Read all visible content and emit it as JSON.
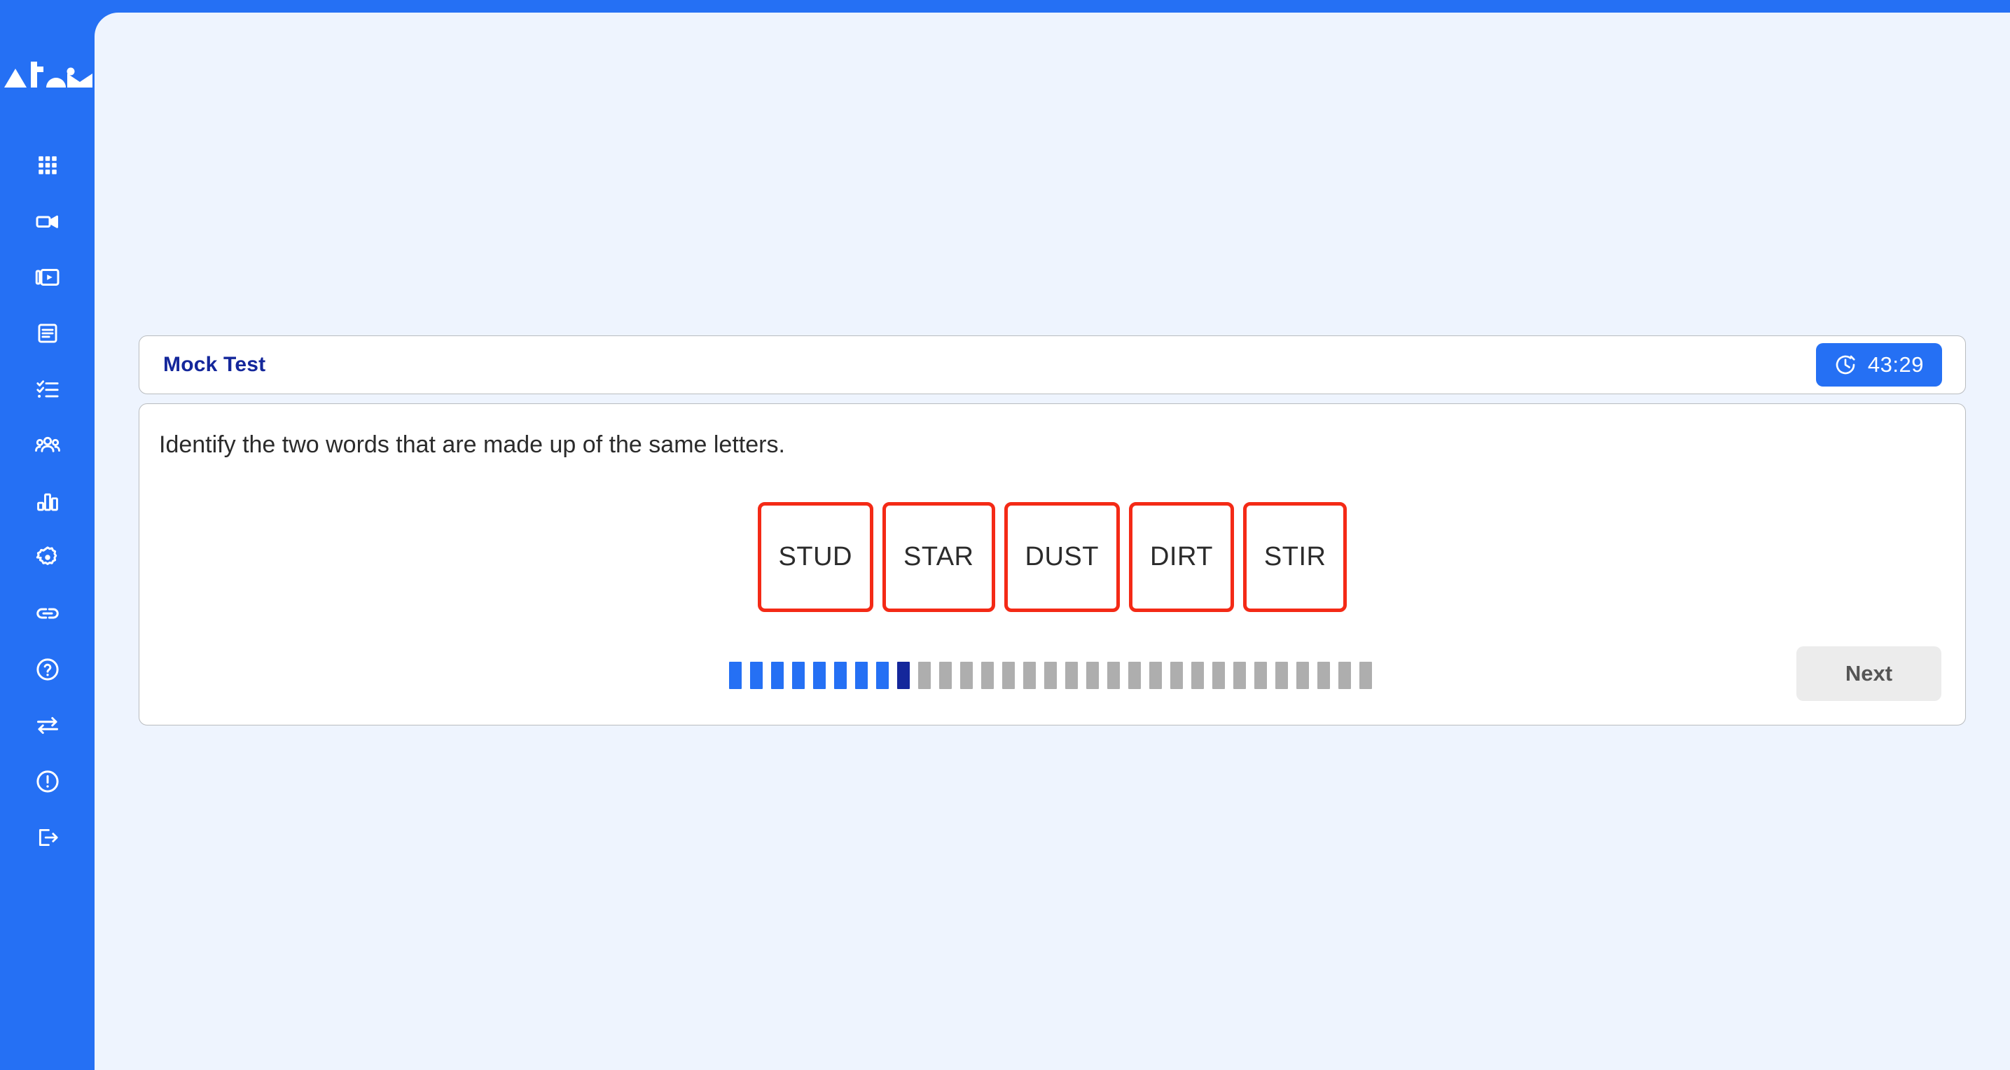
{
  "brand": {
    "logo_text": "Atom",
    "logo_icon": "atom-wordmark-logo",
    "sidebar_color": "#2570f4"
  },
  "sidebar": {
    "items": [
      {
        "icon": "grid-apps-icon",
        "label": "Dashboard"
      },
      {
        "icon": "video-camera-icon",
        "label": "Live Class"
      },
      {
        "icon": "video-library-icon",
        "label": "Recordings"
      },
      {
        "icon": "document-icon",
        "label": "Study Material"
      },
      {
        "icon": "checklist-icon",
        "label": "Tests"
      },
      {
        "icon": "users-group-icon",
        "label": "Students"
      },
      {
        "icon": "bar-chart-icon",
        "label": "Reports"
      },
      {
        "icon": "gear-icon",
        "label": "Settings"
      },
      {
        "icon": "link-icon",
        "label": "Links"
      },
      {
        "icon": "help-circle-icon",
        "label": "Help"
      },
      {
        "icon": "transfer-arrows-icon",
        "label": "Transfer"
      },
      {
        "icon": "alert-circle-icon",
        "label": "Alerts"
      },
      {
        "icon": "logout-icon",
        "label": "Logout"
      }
    ]
  },
  "header": {
    "title": "Mock Test",
    "title_color": "#14279b",
    "timer": {
      "icon": "stopwatch-icon",
      "value": "43:29",
      "background": "#2570f4"
    }
  },
  "question": {
    "prompt": "Identify the two words that are made up of the same letters.",
    "option_border_color": "#f42a16",
    "options": [
      {
        "label": "STUD"
      },
      {
        "label": "STAR"
      },
      {
        "label": "DUST"
      },
      {
        "label": "DIRT"
      },
      {
        "label": "STIR"
      }
    ]
  },
  "progress": {
    "total": 31,
    "completed": 8,
    "current_index": 9,
    "done_color": "#2570f4",
    "current_color": "#14279b",
    "remaining_color": "#aeaeae"
  },
  "footer": {
    "next_label": "Next"
  }
}
